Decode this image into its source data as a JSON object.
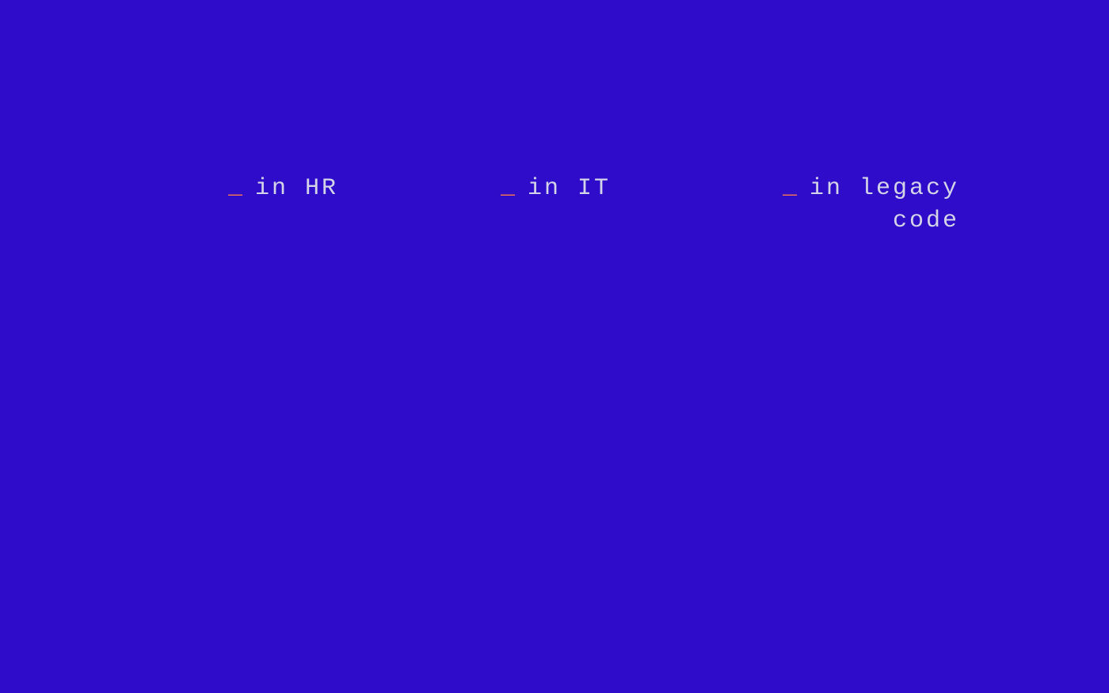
{
  "items": [
    {
      "prefix": "_",
      "label": "in HR"
    },
    {
      "prefix": "_",
      "label": "in IT"
    },
    {
      "prefix": "_",
      "label": "in legacy\ncode"
    }
  ]
}
